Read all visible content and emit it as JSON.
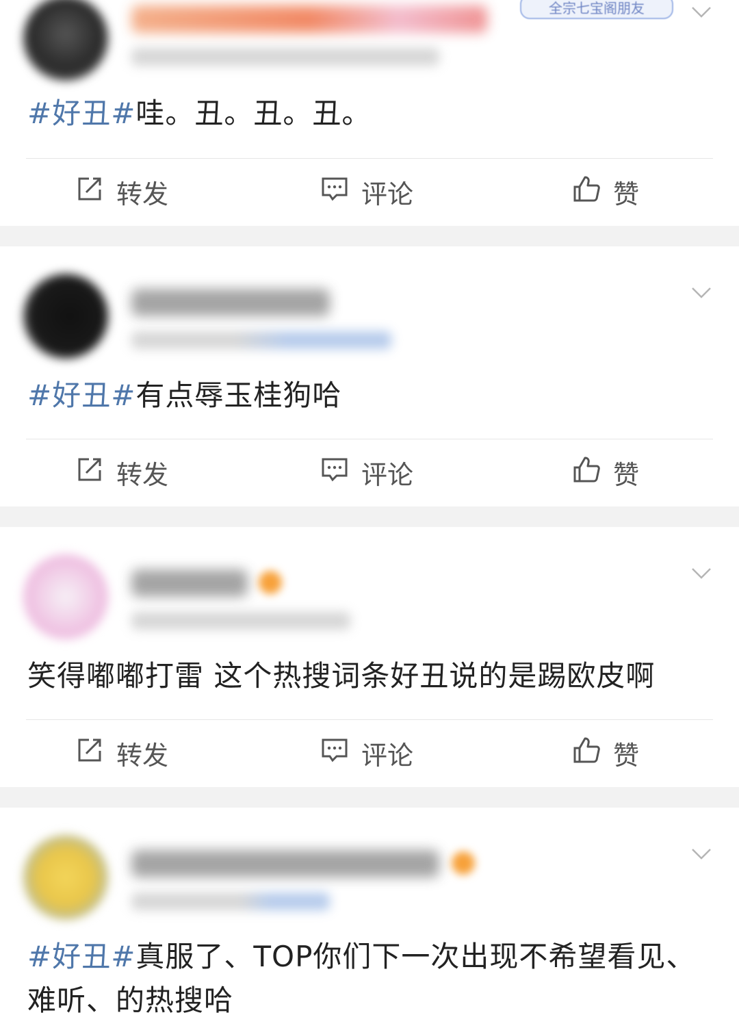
{
  "posts": [
    {
      "text_tag": "#好丑#",
      "text_body": "哇。丑。丑。丑。",
      "actions": {
        "repost": "转发",
        "comment": "评论",
        "like": "赞"
      },
      "badge": "全宗七宝阁朋友"
    },
    {
      "text_tag": "#好丑#",
      "text_body": "有点辱玉桂狗哈",
      "actions": {
        "repost": "转发",
        "comment": "评论",
        "like": "赞"
      }
    },
    {
      "text_tag": "",
      "text_body": "笑得嘟嘟打雷 这个热搜词条好丑说的是踢欧皮啊",
      "actions": {
        "repost": "转发",
        "comment": "评论",
        "like": "赞"
      }
    },
    {
      "text_tag": "#好丑#",
      "text_body": "真服了、TOP你们下一次出现不希望看见、难听、的热搜哈"
    }
  ],
  "colors": {
    "topic_link": "#4f77aa",
    "background": "#f2f2f2",
    "card": "#ffffff"
  },
  "icons": {
    "repost": "repost-icon",
    "comment": "comment-icon",
    "like": "thumbs-up-icon",
    "menu": "chevron-down-icon"
  }
}
